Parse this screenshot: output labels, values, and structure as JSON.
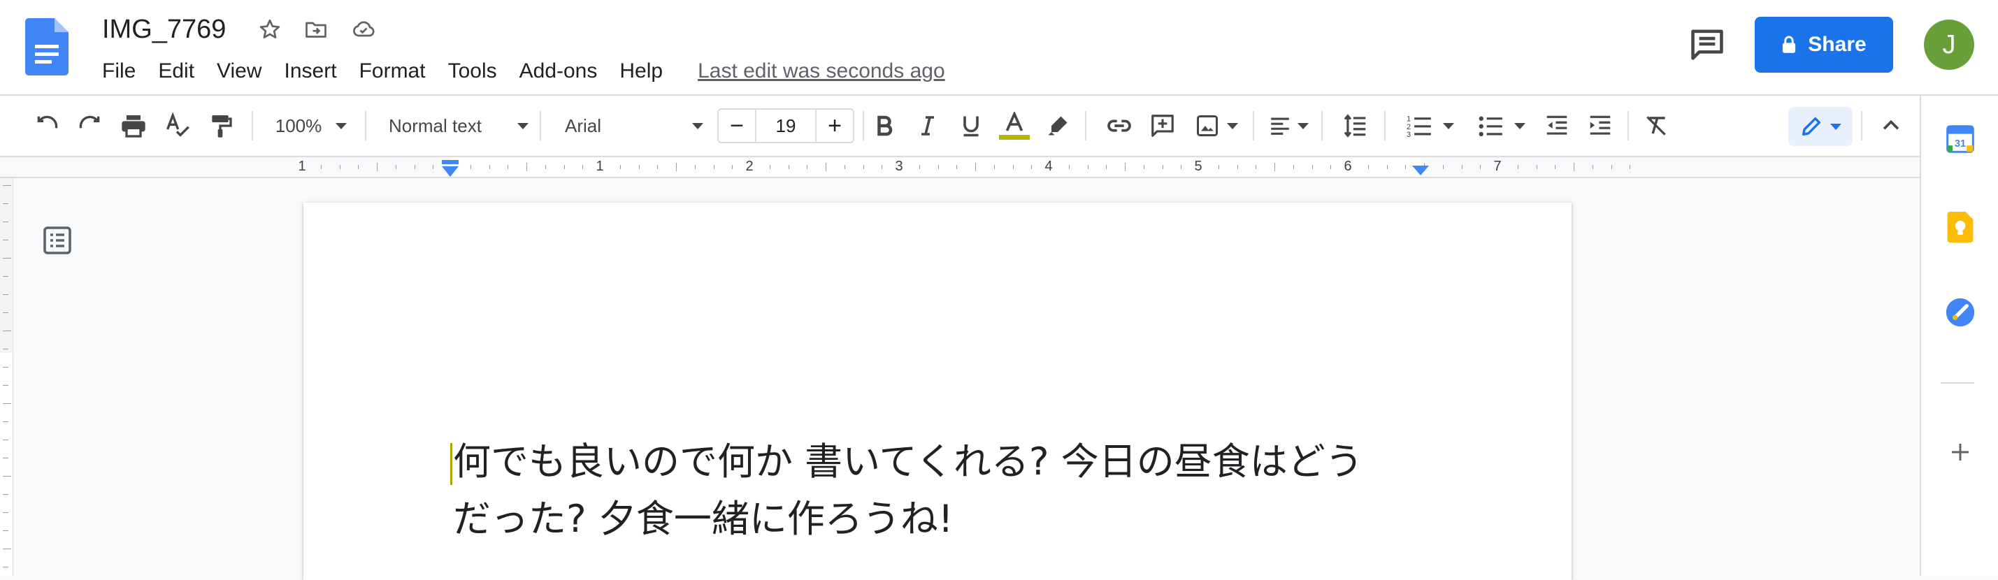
{
  "document": {
    "title": "IMG_7769",
    "last_edit": "Last edit was seconds ago",
    "body_lines": [
      "何でも良いので何か 書いてくれる? 今日の昼食はどう",
      "だった? 夕食一緒に作ろうね!"
    ]
  },
  "menu": [
    "File",
    "Edit",
    "View",
    "Insert",
    "Format",
    "Tools",
    "Add-ons",
    "Help"
  ],
  "header": {
    "share_label": "Share",
    "avatar_initial": "J"
  },
  "toolbar": {
    "zoom": "100%",
    "style": "Normal text",
    "font": "Arial",
    "font_size": "19",
    "decrease": "−",
    "increase": "+"
  },
  "ruler": {
    "labels": [
      "1",
      "1",
      "2",
      "3",
      "4",
      "5",
      "6",
      "7"
    ]
  },
  "colors": {
    "accent": "#1a73e8",
    "avatar": "#689f38",
    "text_color_bar": "#b5b500",
    "docs_blue": "#4285f4",
    "keep_yellow": "#fbbc04"
  },
  "icons": {
    "header": [
      "docs-logo-icon",
      "star-icon",
      "move-to-folder-icon",
      "cloud-saved-icon",
      "comment-icon",
      "lock-icon"
    ],
    "toolbar": [
      "undo-icon",
      "redo-icon",
      "print-icon",
      "spellcheck-icon",
      "paint-format-icon",
      "bold-icon",
      "italic-icon",
      "underline-icon",
      "text-color-icon",
      "highlight-icon",
      "link-icon",
      "add-comment-icon",
      "insert-image-icon",
      "align-icon",
      "line-spacing-icon",
      "numbered-list-icon",
      "bulleted-list-icon",
      "decrease-indent-icon",
      "increase-indent-icon",
      "clear-formatting-icon",
      "edit-mode-icon",
      "collapse-icon"
    ],
    "side_panel": [
      "calendar-icon",
      "keep-icon",
      "tasks-icon",
      "add-icon"
    ]
  }
}
